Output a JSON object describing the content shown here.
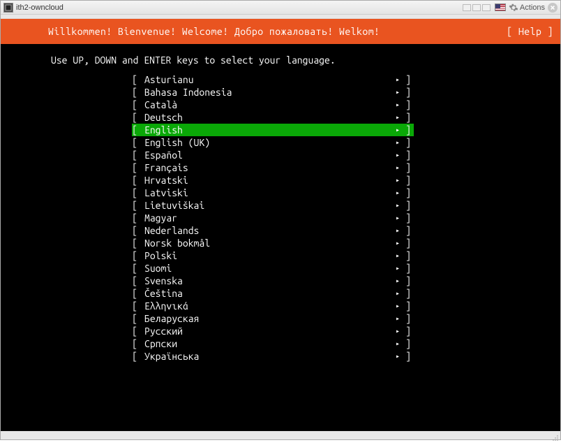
{
  "window": {
    "title": "ith2-owncloud",
    "actions_label": "Actions"
  },
  "header": {
    "welcome": "Willkommen! Bienvenue! Welcome! Добро пожаловать! Welkom!",
    "help": "[ Help ]"
  },
  "instruction": "Use UP, DOWN and ENTER keys to select your language.",
  "selected_index": 4,
  "brackets": {
    "left": "[ ",
    "right": "]"
  },
  "arrow_glyph": "▸",
  "languages": [
    "Asturianu",
    "Bahasa Indonesia",
    "Català",
    "Deutsch",
    "English",
    "English (UK)",
    "Español",
    "Français",
    "Hrvatski",
    "Latviski",
    "Lietuviškai",
    "Magyar",
    "Nederlands",
    "Norsk bokmål",
    "Polski",
    "Suomi",
    "Svenska",
    "Čeština",
    "Ελληνικά",
    "Беларуская",
    "Русский",
    "Српски",
    "Українська"
  ],
  "colors": {
    "accent": "#e95420",
    "selected": "#0aa807",
    "background": "#000000",
    "text": "#ffffff"
  }
}
